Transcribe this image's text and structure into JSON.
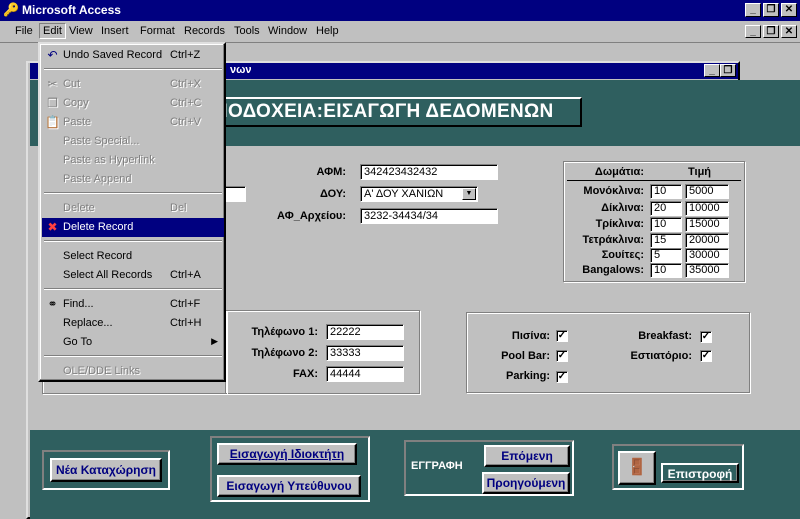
{
  "app": {
    "title": "Microsoft Access",
    "window_buttons": [
      "_",
      "❐",
      "✕"
    ]
  },
  "menubar": {
    "items": [
      "File",
      "Edit",
      "View",
      "Insert",
      "Format",
      "Records",
      "Tools",
      "Window",
      "Help"
    ],
    "active": "Edit"
  },
  "form": {
    "title_fragment": "νων",
    "header_title": "ΝΟΔΟΧΕΙΑ:ΕΙΣΑΓΩΓΗ ΔΕΔΟΜΕΝΩΝ",
    "afm_label": "ΑΦΜ:",
    "afm_value": "342423432432",
    "doy_label": "ΔΟΥ:",
    "doy_value": "Α' ΔΟΥ ΧΑΝΙΩΝ",
    "archive_label": "ΑΦ_Αρχείου:",
    "archive_value": "3232-34434/34",
    "rooms": {
      "col_rooms": "Δωμάτια:",
      "col_price": "Τιμή",
      "rows": [
        {
          "label": "Μονόκλινα:",
          "count": "10",
          "price": "5000"
        },
        {
          "label": "Δίκλινα:",
          "count": "20",
          "price": "10000"
        },
        {
          "label": "Τρίκλινα:",
          "count": "10",
          "price": "15000"
        },
        {
          "label": "Τετράκλινα:",
          "count": "15",
          "price": "20000"
        },
        {
          "label": "Σουίτες:",
          "count": "5",
          "price": "30000"
        },
        {
          "label": "Bangalows:",
          "count": "10",
          "price": "35000"
        }
      ]
    },
    "contact": {
      "phone1_label": "Τηλέφωνο 1:",
      "phone1_value": "22222",
      "phone2_label": "Τηλέφωνο 2:",
      "phone2_value": "33333",
      "fax_label": "FAX:",
      "fax_value": "44444"
    },
    "amenities": {
      "pool_label": "Πισίνα:",
      "poolbar_label": "Pool Bar:",
      "parking_label": "Parking:",
      "breakfast_label": "Breakfast:",
      "restaurant_label": "Εστιατόριο:",
      "check": "✓"
    },
    "footer": {
      "new_entry": "Νέα Καταχώρηση",
      "add_owner": "Εισαγωγή Ιδιοκτήτη",
      "add_manager": "Εισαγωγή Υπεύθυνου",
      "record_label": "ΕΓΓΡΑΦΗ",
      "next": "Επόμενη",
      "previous": "Προηγούμενη",
      "back": "Επιστροφή"
    }
  },
  "edit_menu": {
    "items": [
      {
        "label": "Undo Saved Record",
        "shortcut": "Ctrl+Z",
        "enabled": true,
        "icon": "undo-icon"
      },
      {
        "label": "Cut",
        "shortcut": "Ctrl+X",
        "enabled": false,
        "icon": "scissors-icon"
      },
      {
        "label": "Copy",
        "shortcut": "Ctrl+C",
        "enabled": false,
        "icon": "copy-icon"
      },
      {
        "label": "Paste",
        "shortcut": "Ctrl+V",
        "enabled": false,
        "icon": "paste-icon"
      },
      {
        "label": "Paste Special...",
        "shortcut": "",
        "enabled": false
      },
      {
        "label": "Paste as Hyperlink",
        "shortcut": "",
        "enabled": false
      },
      {
        "label": "Paste Append",
        "shortcut": "",
        "enabled": false
      },
      {
        "label": "Delete",
        "shortcut": "Del",
        "enabled": false
      },
      {
        "label": "Delete Record",
        "shortcut": "",
        "enabled": true,
        "selected": true,
        "icon": "delete-record-icon"
      },
      {
        "label": "Select Record",
        "shortcut": "",
        "enabled": true
      },
      {
        "label": "Select All Records",
        "shortcut": "Ctrl+A",
        "enabled": true
      },
      {
        "label": "Find...",
        "shortcut": "Ctrl+F",
        "enabled": true,
        "icon": "binoculars-icon"
      },
      {
        "label": "Replace...",
        "shortcut": "Ctrl+H",
        "enabled": true
      },
      {
        "label": "Go To",
        "shortcut": "",
        "enabled": true,
        "submenu": true
      },
      {
        "label": "OLE/DDE Links",
        "shortcut": "",
        "enabled": false
      }
    ]
  },
  "colors": {
    "titlebar": "#000080",
    "form_band": "#2f5f5f",
    "face": "#c0c0c0"
  }
}
